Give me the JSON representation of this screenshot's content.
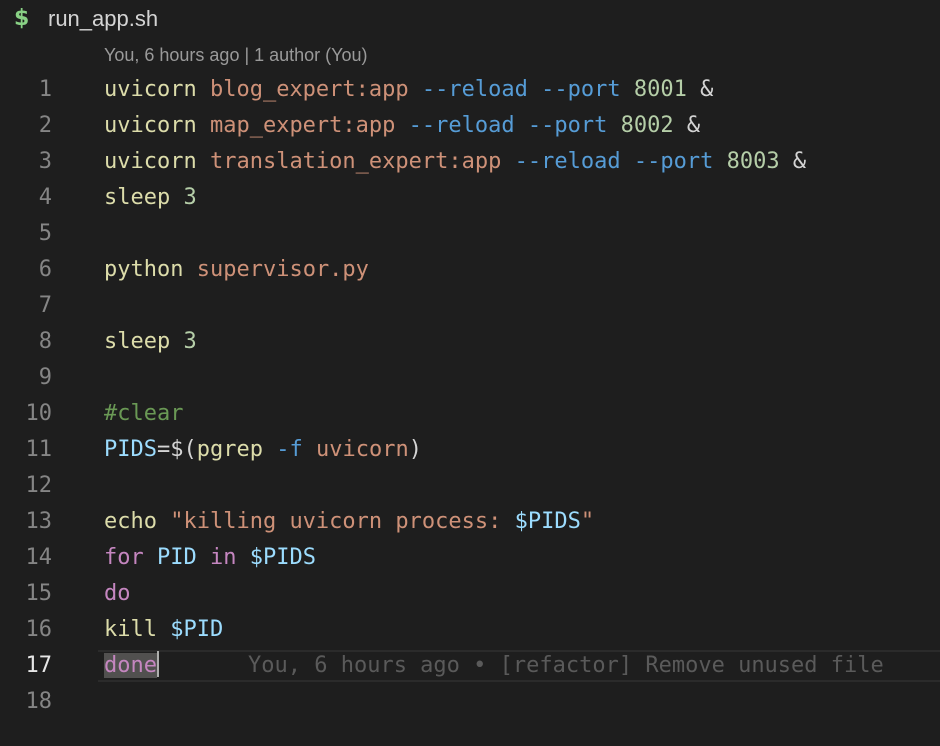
{
  "tab": {
    "icon": "dollar-shell-icon",
    "title": "run_app.sh"
  },
  "blame_header": "You, 6 hours ago | 1 author (You)",
  "lines": {
    "1": {
      "n": "1",
      "t": [
        "uvicorn",
        " ",
        "blog_expert:app",
        " ",
        "--reload",
        " ",
        "--port",
        " ",
        "8001",
        " ",
        "&"
      ]
    },
    "2": {
      "n": "2",
      "t": [
        "uvicorn",
        " ",
        "map_expert:app",
        " ",
        "--reload",
        " ",
        "--port",
        " ",
        "8002",
        " ",
        "&"
      ]
    },
    "3": {
      "n": "3",
      "t": [
        "uvicorn",
        " ",
        "translation_expert:app",
        " ",
        "--reload",
        " ",
        "--port",
        " ",
        "8003",
        " ",
        "&"
      ]
    },
    "4": {
      "n": "4",
      "t": [
        "sleep",
        " ",
        "3"
      ]
    },
    "5": {
      "n": "5"
    },
    "6": {
      "n": "6",
      "t": [
        "python",
        " ",
        "supervisor.py"
      ]
    },
    "7": {
      "n": "7"
    },
    "8": {
      "n": "8",
      "t": [
        "sleep",
        " ",
        "3"
      ]
    },
    "9": {
      "n": "9"
    },
    "10": {
      "n": "10",
      "t": [
        "#clear"
      ]
    },
    "11": {
      "n": "11",
      "t": [
        "PIDS",
        "=$(",
        "pgrep",
        " ",
        "-f",
        " ",
        "uvicorn",
        ")"
      ]
    },
    "12": {
      "n": "12"
    },
    "13": {
      "n": "13",
      "t": [
        "echo",
        " ",
        "\"killing uvicorn process: ",
        "$PIDS",
        "\""
      ]
    },
    "14": {
      "n": "14",
      "t": [
        "for",
        " ",
        "PID",
        " ",
        "in",
        " ",
        "$PIDS"
      ]
    },
    "15": {
      "n": "15",
      "t": [
        "do"
      ]
    },
    "16": {
      "n": "16",
      "t": [
        "kill",
        " ",
        "$PID"
      ]
    },
    "17": {
      "n": "17",
      "t": [
        "done"
      ]
    },
    "18": {
      "n": "18"
    }
  },
  "inline_blame": "You, 6 hours ago • [refactor] Remove unused file",
  "colors": {
    "background": "#1e1e1e",
    "command": "#dcdcaa",
    "string": "#ce9178",
    "flag": "#569cd6",
    "number": "#b5cea8",
    "variable": "#9cdcfe",
    "keyword": "#c586c0",
    "comment": "#6a9955"
  }
}
